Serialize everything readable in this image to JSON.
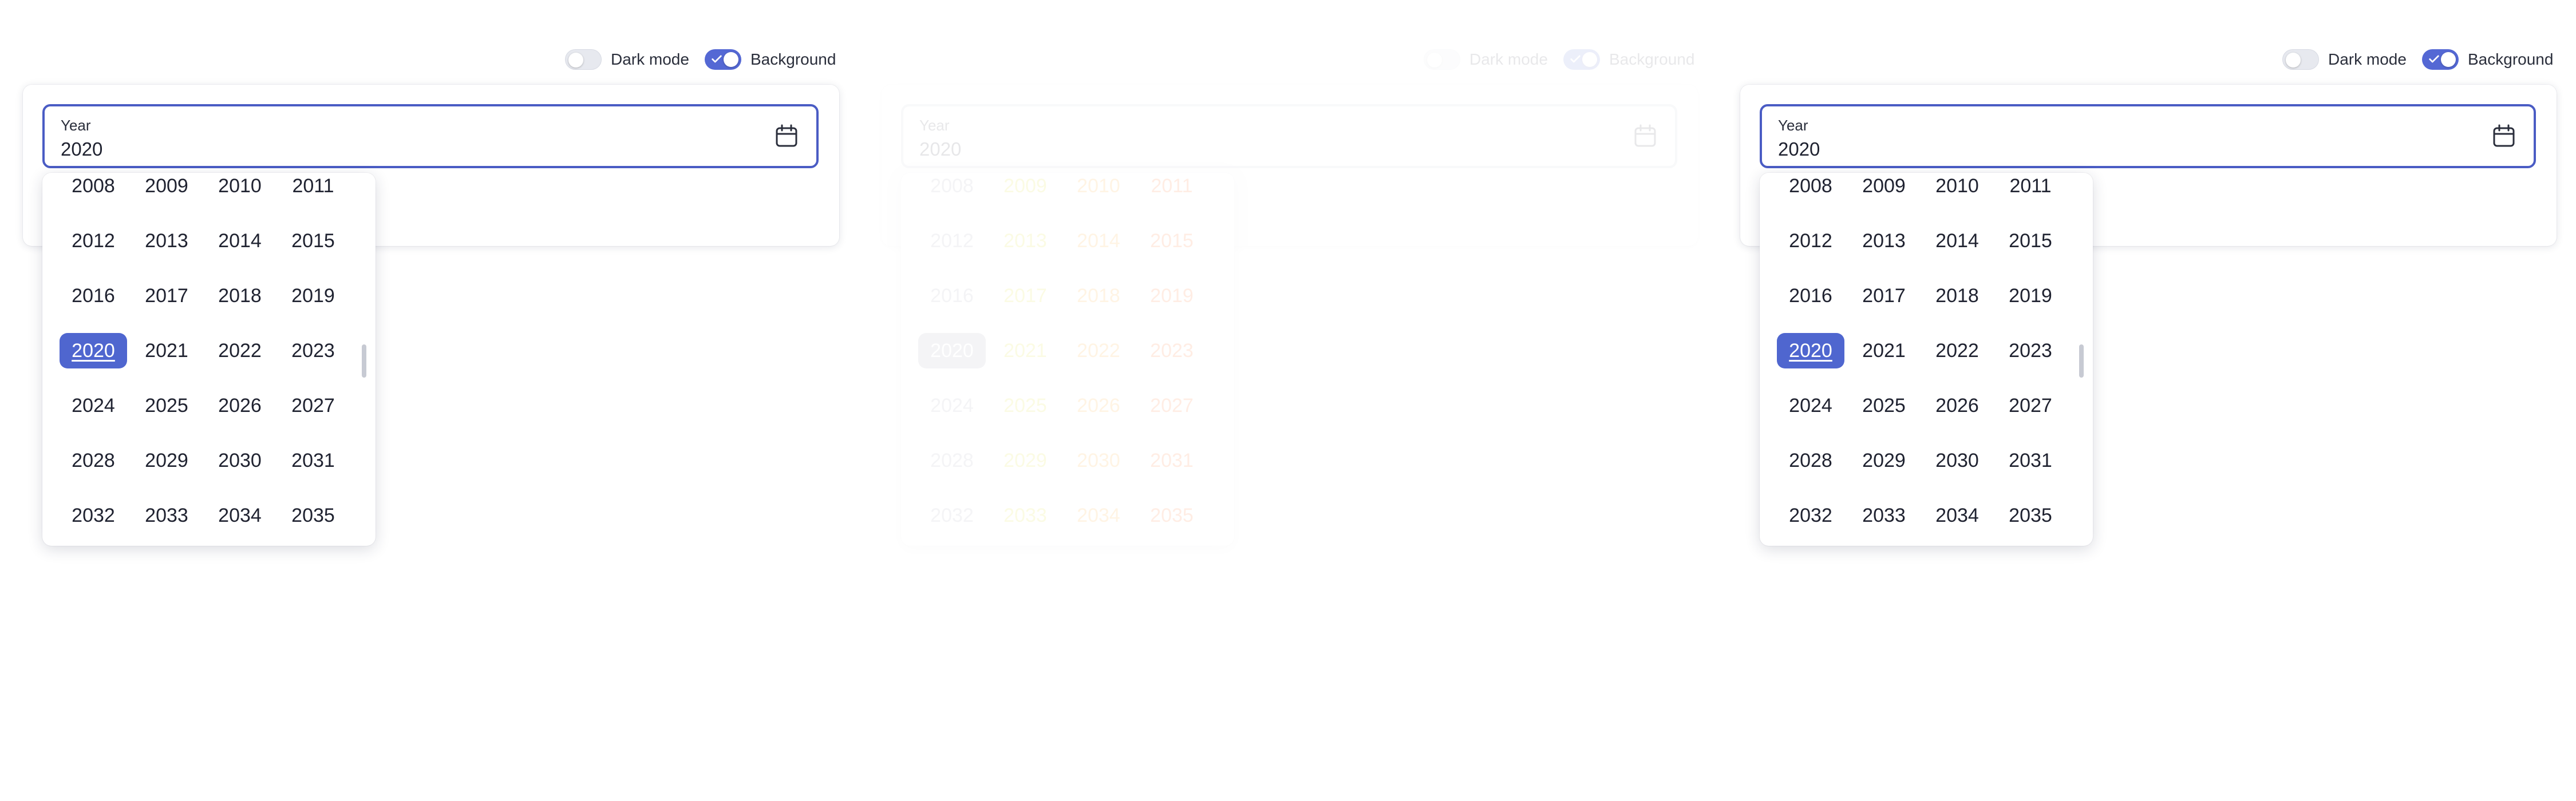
{
  "toggles": {
    "dark_mode_label": "Dark mode",
    "background_label": "Background"
  },
  "field": {
    "label": "Year",
    "value": "2020"
  },
  "years": [
    "2008",
    "2009",
    "2010",
    "2011",
    "2012",
    "2013",
    "2014",
    "2015",
    "2016",
    "2017",
    "2018",
    "2019",
    "2020",
    "2021",
    "2022",
    "2023",
    "2024",
    "2025",
    "2026",
    "2027",
    "2028",
    "2029",
    "2030",
    "2031",
    "2032",
    "2033",
    "2034",
    "2035"
  ],
  "selected_year": "2020",
  "colors": {
    "accent": "#4f66cf",
    "field_border": "#4a5cc4",
    "middle_col_1": "#e0e000",
    "middle_col_2": "#ff9800",
    "middle_col_3": "#ff5500"
  },
  "panels": [
    {
      "dark_mode": false,
      "background": true
    },
    {
      "dark_mode": false,
      "background": true
    },
    {
      "dark_mode": false,
      "background": true
    }
  ]
}
